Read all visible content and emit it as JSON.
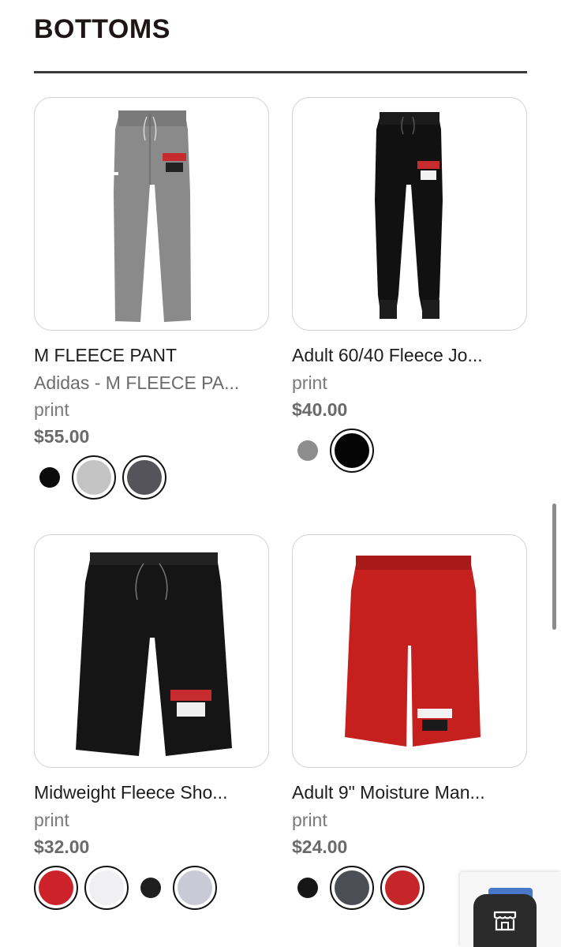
{
  "section": {
    "title": "BOTTOMS"
  },
  "products": [
    {
      "name": "M FLEECE PANT",
      "subtitle": "Adidas - M FLEECE PA...",
      "decoration": "print",
      "price": "$55.00",
      "image_icon": "grey-fleece-pant",
      "swatches": [
        {
          "color": "#0b0b0b",
          "selected": false
        },
        {
          "color": "#c4c4c4",
          "selected": true
        },
        {
          "color": "#54545a",
          "selected": true
        }
      ]
    },
    {
      "name": "Adult 60/40 Fleece Jo...",
      "subtitle": "",
      "decoration": "print",
      "price": "$40.00",
      "image_icon": "black-jogger",
      "swatches": [
        {
          "color": "#8d8d8d",
          "selected": false
        },
        {
          "color": "#050505",
          "selected": true
        }
      ]
    },
    {
      "name": "Midweight Fleece Sho...",
      "subtitle": "",
      "decoration": "print",
      "price": "$32.00",
      "image_icon": "black-fleece-shorts",
      "swatches": [
        {
          "color": "#cc2229",
          "selected": true
        },
        {
          "color": "#f0f0f2",
          "selected": true
        },
        {
          "color": "#1f1f1f",
          "selected": false
        },
        {
          "color": "#c9cad6",
          "selected": true
        }
      ]
    },
    {
      "name": "Adult 9\" Moisture Man...",
      "subtitle": "",
      "decoration": "print",
      "price": "$24.00",
      "image_icon": "red-moisture-shorts",
      "swatches": [
        {
          "color": "#161616",
          "selected": false
        },
        {
          "color": "#4b4f55",
          "selected": true
        },
        {
          "color": "#c4262a",
          "selected": true
        }
      ]
    }
  ],
  "floating": {
    "store_icon": "storefront-icon",
    "recaptcha_icon": "recaptcha-icon"
  },
  "colors": {
    "title": "#1e1616",
    "rule": "#3a3a3a",
    "price": "#6a6a6a",
    "brand_red": "#d3262b"
  }
}
